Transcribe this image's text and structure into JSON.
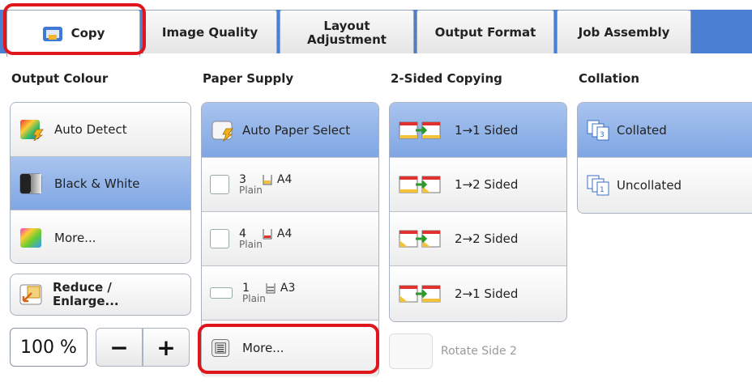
{
  "tabs": [
    {
      "label": "Copy",
      "icon": "copy-icon",
      "active": true
    },
    {
      "label": "Image Quality"
    },
    {
      "label": "Layout Adjustment"
    },
    {
      "label": "Output Format"
    },
    {
      "label": "Job Assembly"
    }
  ],
  "output_colour": {
    "title": "Output Colour",
    "options": [
      {
        "label": "Auto Detect",
        "icon": "auto-colour-icon",
        "selected": false
      },
      {
        "label": "Black & White",
        "icon": "black-white-icon",
        "selected": true
      },
      {
        "label": "More...",
        "icon": "colour-palette-icon",
        "selected": false
      }
    ]
  },
  "reduce_enlarge": {
    "label": "Reduce / Enlarge...",
    "icon": "reduce-enlarge-icon"
  },
  "zoom": {
    "value": "100 %",
    "minus": "−",
    "plus": "+"
  },
  "paper_supply": {
    "title": "Paper Supply",
    "auto": {
      "label": "Auto Paper Select",
      "icon": "auto-paper-icon",
      "selected": true
    },
    "trays": [
      {
        "num": "3",
        "type": "Plain",
        "size": "A4"
      },
      {
        "num": "4",
        "type": "Plain",
        "size": "A4"
      },
      {
        "num": "1",
        "type": "Plain",
        "size": "A3"
      }
    ],
    "more": {
      "label": "More...",
      "icon": "paper-list-icon"
    }
  },
  "two_sided": {
    "title": "2-Sided Copying",
    "options": [
      {
        "label": "1→1 Sided",
        "selected": true
      },
      {
        "label": "1→2 Sided",
        "selected": false
      },
      {
        "label": "2→2 Sided",
        "selected": false
      },
      {
        "label": "2→1 Sided",
        "selected": false
      }
    ],
    "rotate": {
      "label": "Rotate Side 2",
      "disabled": true
    }
  },
  "collation": {
    "title": "Collation",
    "options": [
      {
        "label": "Collated",
        "selected": true
      },
      {
        "label": "Uncollated",
        "selected": false
      }
    ]
  },
  "colors": {
    "accent": "#4a7fd4",
    "selected": "#7fa6e4",
    "highlight": "#e0161d"
  }
}
